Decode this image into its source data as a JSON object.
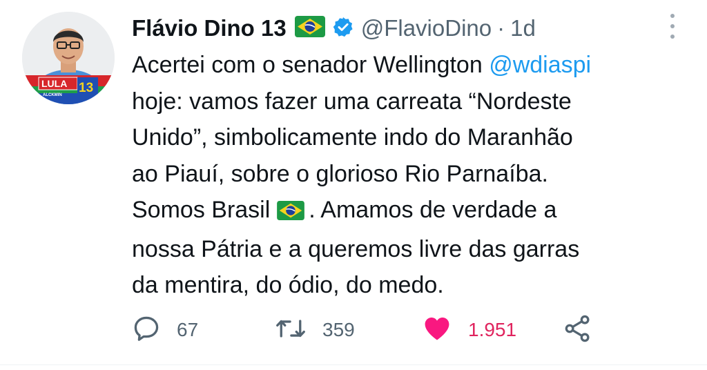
{
  "author": {
    "name": "Flávio Dino 13",
    "handle": "@FlavioDino",
    "separator": "·",
    "time": "1d",
    "avatar": {
      "badge_text": "LULA",
      "badge_number": "13",
      "badge_subtext": "ALCKMIN"
    }
  },
  "tweet": {
    "lines": [
      {
        "before": "Acertei com o senador Wellington ",
        "mention": "@wdiaspi"
      },
      {
        "text": "hoje: vamos fazer uma carreata “Nordeste"
      },
      {
        "text": "Unido”, simbolicamente indo do Maranhão"
      },
      {
        "text": "ao Piauí, sobre o glorioso Rio Parnaíba."
      },
      {
        "before": "Somos Brasil",
        "after": ". Amamos de verdade a"
      },
      {
        "text": "nossa Pátria e a queremos livre das garras"
      },
      {
        "text": "da mentira, do ódio, do medo."
      }
    ]
  },
  "actions": {
    "replies": "67",
    "retweets": "359",
    "likes": "1.951"
  },
  "colors": {
    "accent": "#1d9bf0",
    "like": "#f91880",
    "muted": "#536471",
    "text": "#0f1419"
  },
  "icons": [
    "brazil-flag-icon",
    "verified-badge-icon",
    "more-options-icon",
    "reply-icon",
    "retweet-icon",
    "heart-icon",
    "share-icon"
  ]
}
